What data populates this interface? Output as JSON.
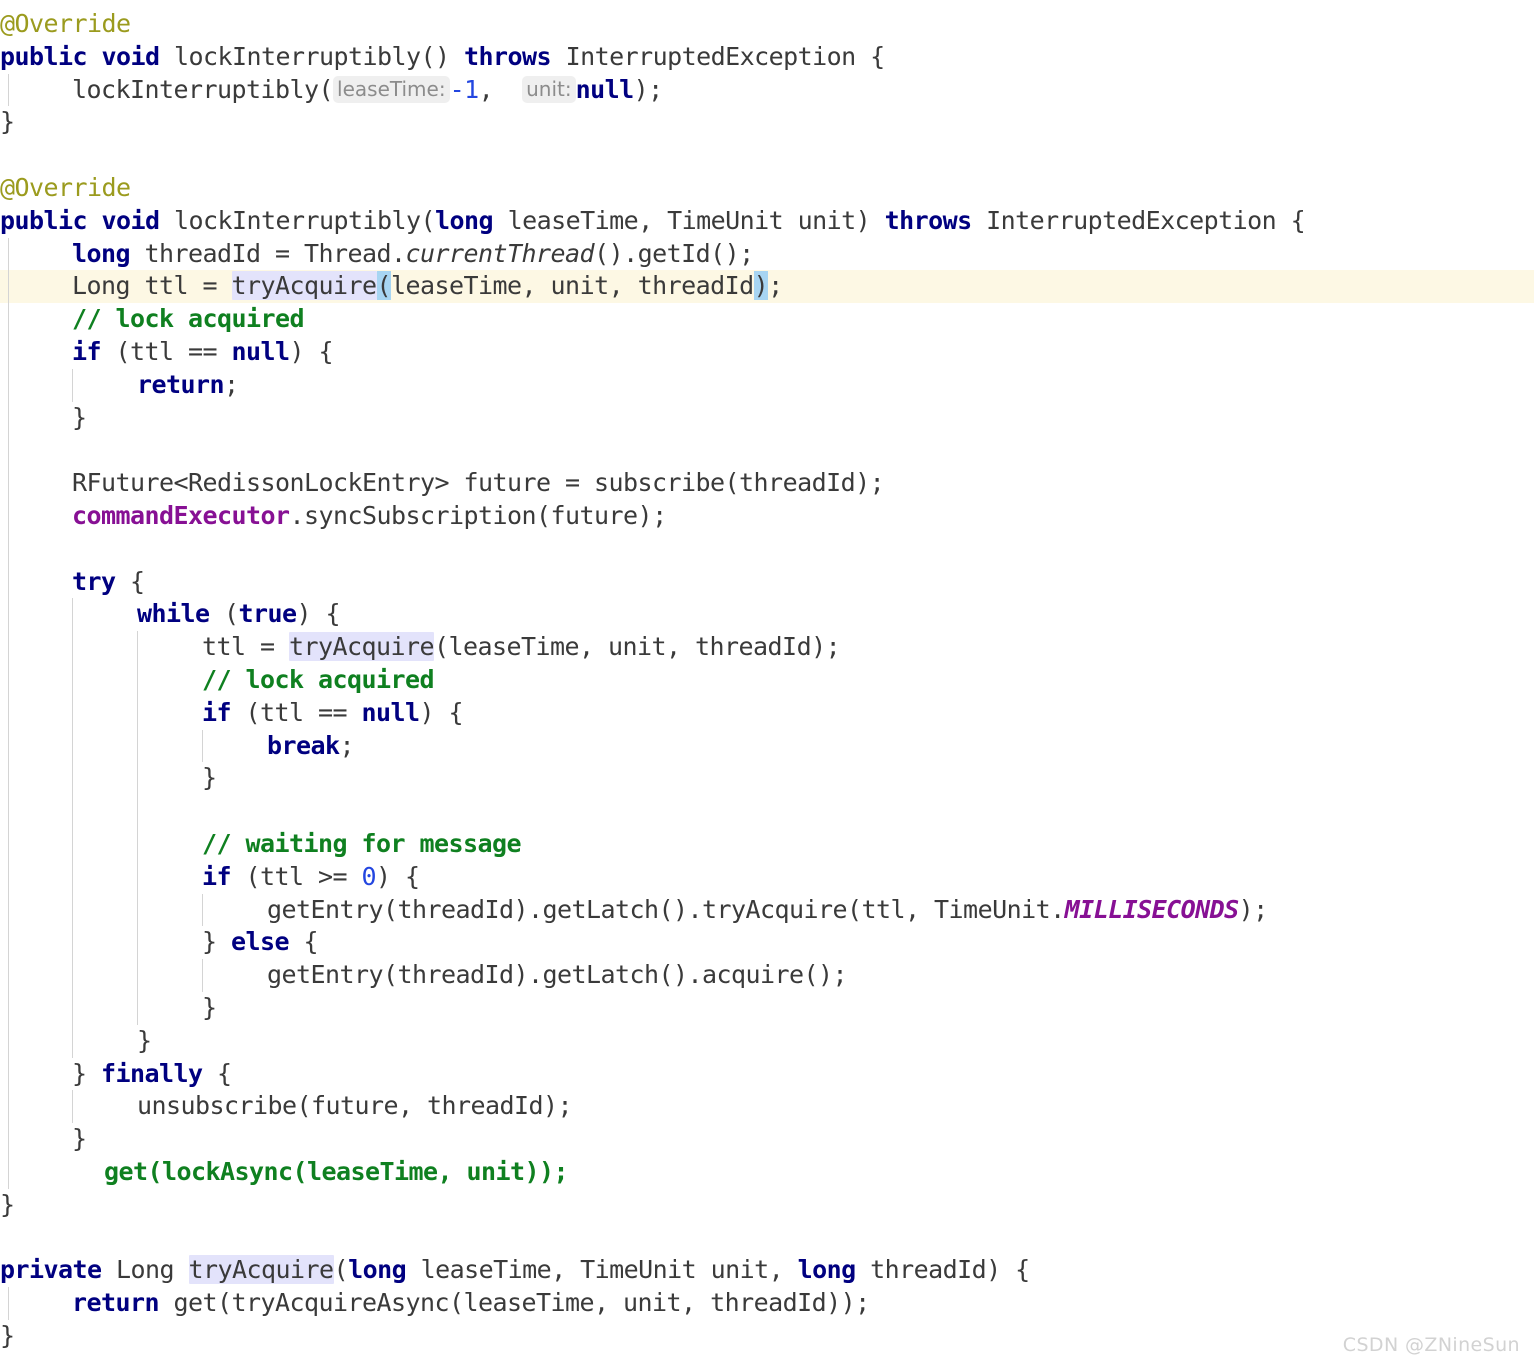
{
  "editor": {
    "language": "Java",
    "font_size_px": 25,
    "line_height_px": 32.8,
    "background_color": "#ffffff",
    "current_line_color": "#fdf8e4",
    "usage_highlight_color": "#e3e3fb",
    "brace_match_color": "#a7d5f2",
    "indent_guide_color": "#d4d4d4",
    "colors": {
      "keyword": "#000080",
      "annotation": "#9b9b1e",
      "comment": "#0f8020",
      "number": "#2346e0",
      "field": "#871094",
      "constant": "#871094",
      "plain": "#3a3a3a",
      "added_line": "#0f8020",
      "inlay_hint_text": "#8c8c8c",
      "inlay_hint_bg": "#efefef"
    }
  },
  "lines": [
    {
      "n": 1,
      "indent": 0,
      "current": false,
      "text": "@Override"
    },
    {
      "n": 2,
      "indent": 0,
      "current": false,
      "text": "public void lockInterruptibly() throws InterruptedException {"
    },
    {
      "n": 3,
      "indent": 1,
      "current": false,
      "text": "lockInterruptibly(leaseTime: -1,  unit: null);"
    },
    {
      "n": 4,
      "indent": 0,
      "current": false,
      "text": "}"
    },
    {
      "n": 5,
      "indent": 0,
      "current": false,
      "text": ""
    },
    {
      "n": 6,
      "indent": 0,
      "current": false,
      "text": "@Override"
    },
    {
      "n": 7,
      "indent": 0,
      "current": false,
      "text": "public void lockInterruptibly(long leaseTime, TimeUnit unit) throws InterruptedException {"
    },
    {
      "n": 8,
      "indent": 1,
      "current": false,
      "text": "long threadId = Thread.currentThread().getId();"
    },
    {
      "n": 9,
      "indent": 1,
      "current": true,
      "text": "Long ttl = tryAcquire(leaseTime, unit, threadId);"
    },
    {
      "n": 10,
      "indent": 1,
      "current": false,
      "text": "// lock acquired"
    },
    {
      "n": 11,
      "indent": 1,
      "current": false,
      "text": "if (ttl == null) {"
    },
    {
      "n": 12,
      "indent": 2,
      "current": false,
      "text": "return;"
    },
    {
      "n": 13,
      "indent": 1,
      "current": false,
      "text": "}"
    },
    {
      "n": 14,
      "indent": 1,
      "current": false,
      "text": ""
    },
    {
      "n": 15,
      "indent": 1,
      "current": false,
      "text": "RFuture<RedissonLockEntry> future = subscribe(threadId);"
    },
    {
      "n": 16,
      "indent": 1,
      "current": false,
      "text": "commandExecutor.syncSubscription(future);"
    },
    {
      "n": 17,
      "indent": 1,
      "current": false,
      "text": ""
    },
    {
      "n": 18,
      "indent": 1,
      "current": false,
      "text": "try {"
    },
    {
      "n": 19,
      "indent": 2,
      "current": false,
      "text": "while (true) {"
    },
    {
      "n": 20,
      "indent": 3,
      "current": false,
      "text": "ttl = tryAcquire(leaseTime, unit, threadId);"
    },
    {
      "n": 21,
      "indent": 3,
      "current": false,
      "text": "// lock acquired"
    },
    {
      "n": 22,
      "indent": 3,
      "current": false,
      "text": "if (ttl == null) {"
    },
    {
      "n": 23,
      "indent": 4,
      "current": false,
      "text": "break;"
    },
    {
      "n": 24,
      "indent": 3,
      "current": false,
      "text": "}"
    },
    {
      "n": 25,
      "indent": 3,
      "current": false,
      "text": ""
    },
    {
      "n": 26,
      "indent": 3,
      "current": false,
      "text": "// waiting for message"
    },
    {
      "n": 27,
      "indent": 3,
      "current": false,
      "text": "if (ttl >= 0) {"
    },
    {
      "n": 28,
      "indent": 4,
      "current": false,
      "text": "getEntry(threadId).getLatch().tryAcquire(ttl, TimeUnit.MILLISECONDS);"
    },
    {
      "n": 29,
      "indent": 3,
      "current": false,
      "text": "} else {"
    },
    {
      "n": 30,
      "indent": 4,
      "current": false,
      "text": "getEntry(threadId).getLatch().acquire();"
    },
    {
      "n": 31,
      "indent": 3,
      "current": false,
      "text": "}"
    },
    {
      "n": 32,
      "indent": 2,
      "current": false,
      "text": "}"
    },
    {
      "n": 33,
      "indent": 1,
      "current": false,
      "text": "} finally {"
    },
    {
      "n": 34,
      "indent": 2,
      "current": false,
      "text": "unsubscribe(future, threadId);"
    },
    {
      "n": 35,
      "indent": 1,
      "current": false,
      "text": "}"
    },
    {
      "n": 36,
      "indent": 1,
      "current": false,
      "text": "  get(lockAsync(leaseTime, unit));"
    },
    {
      "n": 37,
      "indent": 0,
      "current": false,
      "text": "}"
    },
    {
      "n": 38,
      "indent": 0,
      "current": false,
      "text": ""
    },
    {
      "n": 39,
      "indent": 0,
      "current": false,
      "text": "private Long tryAcquire(long leaseTime, TimeUnit unit, long threadId) {"
    },
    {
      "n": 40,
      "indent": 1,
      "current": false,
      "text": "return get(tryAcquireAsync(leaseTime, unit, threadId));"
    },
    {
      "n": 41,
      "indent": 0,
      "current": false,
      "text": "}"
    }
  ],
  "inlay_hints": [
    {
      "line": 3,
      "label": "leaseTime:"
    },
    {
      "line": 3,
      "label": "unit:"
    }
  ],
  "watermark": {
    "text": "CSDN @ZNineSun"
  }
}
